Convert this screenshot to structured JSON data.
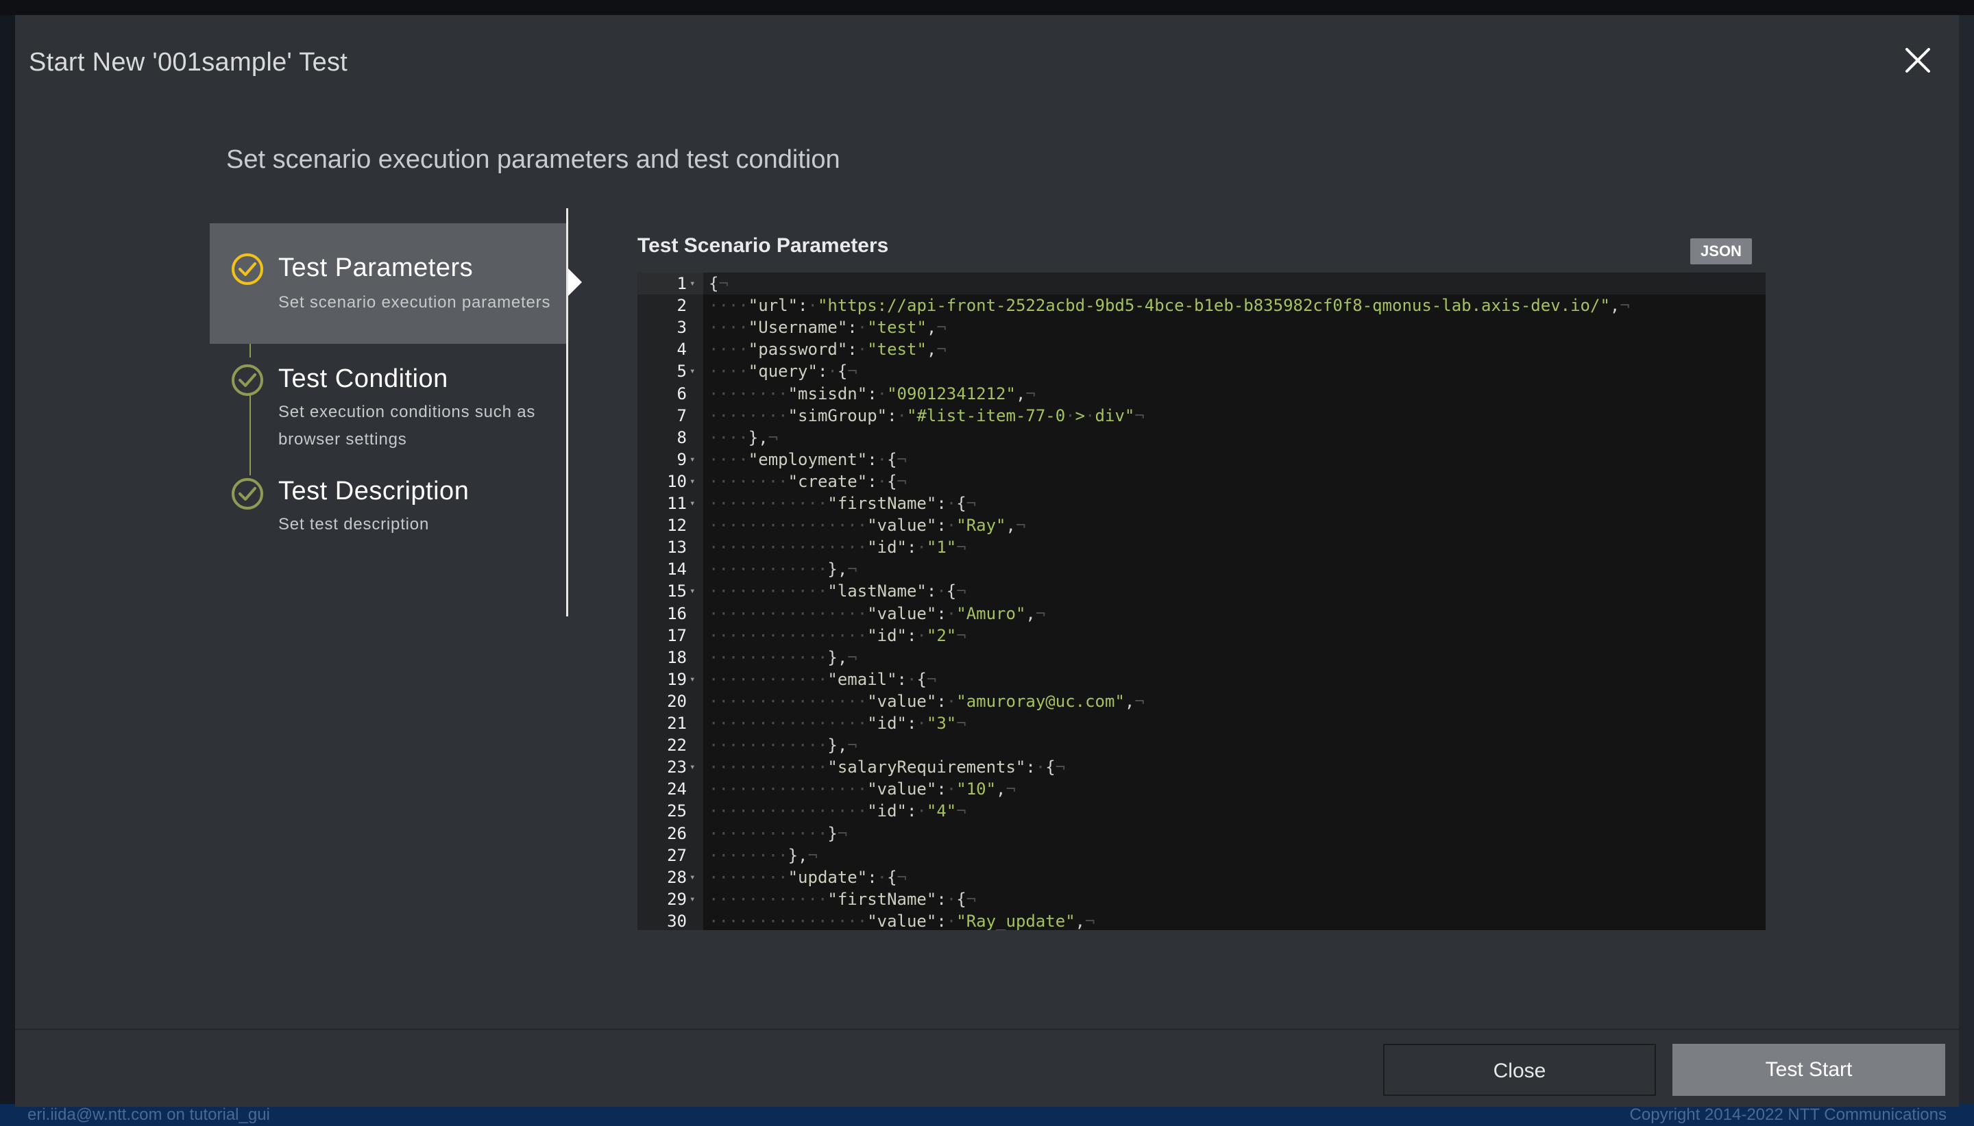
{
  "modal": {
    "title": "Start New '001sample' Test",
    "subtitle": "Set scenario execution parameters and test condition"
  },
  "steps": [
    {
      "title": "Test Parameters",
      "description": "Set scenario execution parameters",
      "active": true
    },
    {
      "title": "Test Condition",
      "description": "Set execution conditions such as browser settings",
      "active": false
    },
    {
      "title": "Test Description",
      "description": "Set test description",
      "active": false
    }
  ],
  "editor": {
    "title": "Test Scenario Parameters",
    "mode_badge": "JSON",
    "lines": [
      "{",
      "    \"url\": \"https://api-front-2522acbd-9bd5-4bce-b1eb-b835982cf0f8-qmonus-lab.axis-dev.io/\",",
      "    \"Username\": \"test\",",
      "    \"password\": \"test\",",
      "    \"query\": {",
      "        \"msisdn\": \"09012341212\",",
      "        \"simGroup\": \"#list-item-77-0 > div\"",
      "    },",
      "    \"employment\": {",
      "        \"create\": {",
      "            \"firstName\": {",
      "                \"value\": \"Ray\",",
      "                \"id\": \"1\"",
      "            },",
      "            \"lastName\": {",
      "                \"value\": \"Amuro\",",
      "                \"id\": \"2\"",
      "            },",
      "            \"email\": {",
      "                \"value\": \"amuroray@uc.com\",",
      "                \"id\": \"3\"",
      "            },",
      "            \"salaryRequirements\": {",
      "                \"value\": \"10\",",
      "                \"id\": \"4\"",
      "            }",
      "        },",
      "        \"update\": {",
      "            \"firstName\": {",
      "                \"value\": \"Ray_update\","
    ],
    "foldable_lines": [
      1,
      5,
      9,
      10,
      11,
      15,
      19,
      23,
      28,
      29
    ]
  },
  "footer": {
    "close_label": "Close",
    "start_label": "Test Start"
  },
  "background": {
    "status_left": "eri.iida@w.ntt.com  on  tutorial_gui",
    "status_right": "Copyright 2014-2022 NTT Communications"
  },
  "colors": {
    "modal_bg": "#2f3338",
    "active_step_bg": "#5a5e63",
    "active_step_check": "#f2c21a",
    "inactive_step_check": "#8f9b54",
    "editor_bg": "#141414",
    "string_color": "#a5c261"
  },
  "icons": {
    "close": "close-icon",
    "step_check": "check-circle-icon"
  }
}
